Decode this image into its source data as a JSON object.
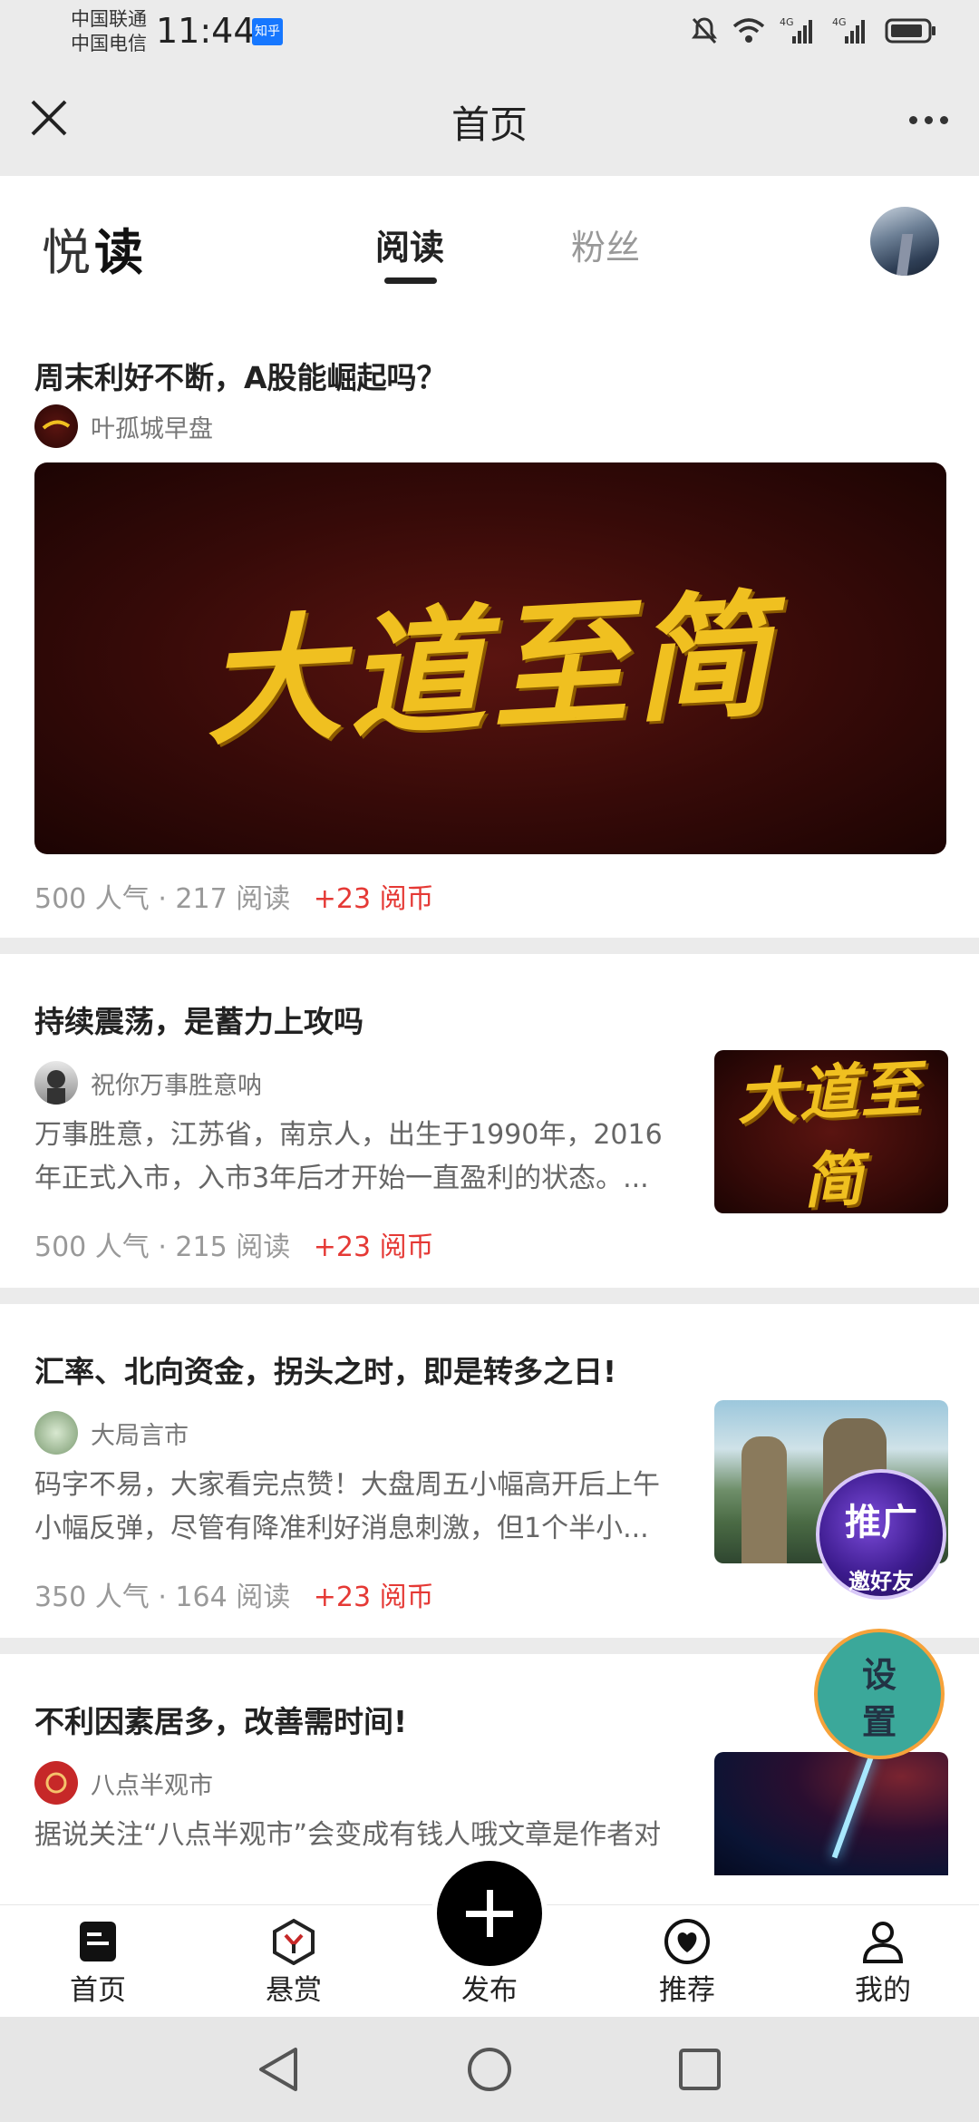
{
  "status_bar": {
    "carrier1": "中国联通",
    "carrier2": "中国电信",
    "time": "11:44",
    "app_badge": "知乎",
    "network1": "4G",
    "network2": "4G"
  },
  "titlebar": {
    "title": "首页"
  },
  "header": {
    "logo_a": "悦",
    "logo_b": "读",
    "tabs": [
      {
        "label": "阅读",
        "active": true
      },
      {
        "label": "粉丝",
        "active": false
      }
    ]
  },
  "articles": [
    {
      "title": "周末利好不断，A股能崛起吗？",
      "author": "叶孤城早盘",
      "cover_text": "大道至简",
      "popularity": "500 人气",
      "reads": "217 阅读",
      "coins": "+23 阅币"
    },
    {
      "title": "持续震荡，是蓄力上攻吗",
      "author": "祝你万事胜意呐",
      "excerpt_line1": "万事胜意，江苏省，南京人，出生于1990年，2016",
      "excerpt_line2": "年正式入市，入市3年后才开始一直盈利的状态。...",
      "cover_text": "大道至简",
      "popularity": "500 人气",
      "reads": "215 阅读",
      "coins": "+23 阅币"
    },
    {
      "title": "汇率、北向资金，拐头之时，即是转多之日!",
      "author": "大局言市",
      "excerpt_line1": "码字不易，大家看完点赞！大盘周五小幅高开后上午",
      "excerpt_line2": "小幅反弹，尽管有降准利好消息刺激，但1个半小...",
      "popularity": "350 人气",
      "reads": "164 阅读",
      "coins": "+23 阅币"
    },
    {
      "title": "不利因素居多，改善需时间!",
      "author": "八点半观市",
      "excerpt_line1": "据说关注“八点半观市”会变成有钱人哦文章是作者对"
    }
  ],
  "floating": {
    "promo_line1": "推广",
    "promo_line2": "邀好友",
    "settings_line1": "设",
    "settings_line2": "置"
  },
  "bottom_nav": [
    {
      "label": "首页",
      "icon": "document-icon"
    },
    {
      "label": "悬赏",
      "icon": "reward-icon"
    },
    {
      "label": "发布",
      "icon": "plus-icon"
    },
    {
      "label": "推荐",
      "icon": "heart-icon"
    },
    {
      "label": "我的",
      "icon": "person-icon"
    }
  ],
  "colors": {
    "accent_red": "#e53935",
    "background": "#ebebeb"
  }
}
